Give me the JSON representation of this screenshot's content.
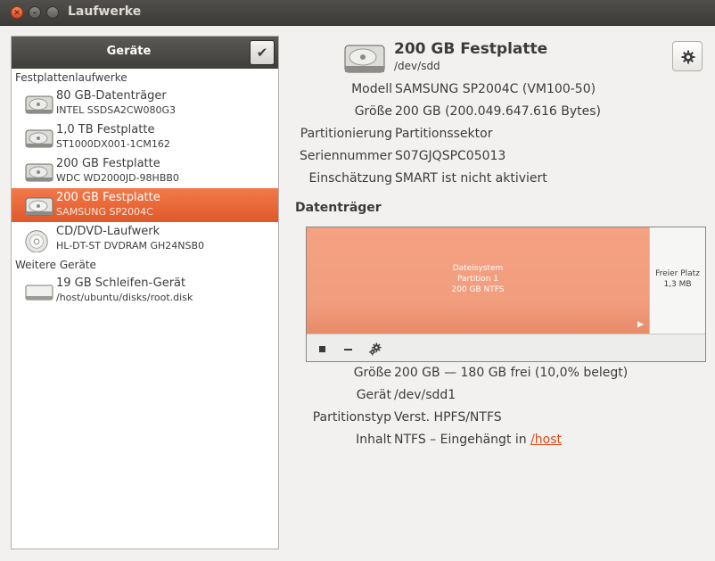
{
  "window": {
    "title": "Laufwerke"
  },
  "sidebar": {
    "header": "Geräte",
    "sections": [
      {
        "title": "Festplattenlaufwerke"
      },
      {
        "title": "Weitere Geräte"
      }
    ],
    "items": [
      {
        "name": "80 GB-Datenträger",
        "sub": "INTEL SSDSA2CW080G3",
        "icon": "harddisk-icon"
      },
      {
        "name": "1,0 TB Festplatte",
        "sub": "ST1000DX001-1CM162",
        "icon": "harddisk-icon"
      },
      {
        "name": "200 GB Festplatte",
        "sub": "WDC WD2000JD-98HBB0",
        "icon": "harddisk-icon"
      },
      {
        "name": "200 GB Festplatte",
        "sub": "SAMSUNG SP2004C",
        "icon": "harddisk-icon",
        "selected": true
      },
      {
        "name": "CD/DVD-Laufwerk",
        "sub": "HL-DT-ST DVDRAM GH24NSB0",
        "icon": "optical-disc-icon"
      },
      {
        "name": "19 GB Schleifen-Gerät",
        "sub": "/host/ubuntu/disks/root.disk",
        "icon": "loop-device-icon"
      }
    ]
  },
  "drive": {
    "title": "200 GB Festplatte",
    "device": "/dev/sdd",
    "props": [
      {
        "key": "Modell",
        "value": "SAMSUNG SP2004C (VM100-50)"
      },
      {
        "key": "Größe",
        "value": "200 GB (200.049.647.616 Bytes)"
      },
      {
        "key": "Partitionierung",
        "value": "Partitionssektor"
      },
      {
        "key": "Seriennummer",
        "value": "S07GJQSPC05013"
      },
      {
        "key": "Einschätzung",
        "value": "SMART ist nicht aktiviert"
      }
    ]
  },
  "volumes": {
    "title": "Datenträger",
    "partition": {
      "line1": "Dateisystem",
      "line2": "Partition 1",
      "line3": "200 GB NTFS"
    },
    "free": {
      "line1": "Freier Platz",
      "line2": "1,3 MB"
    },
    "props": [
      {
        "key": "Größe",
        "value": "200 GB — 180 GB frei (10,0% belegt)"
      },
      {
        "key": "Gerät",
        "value": "/dev/sdd1"
      },
      {
        "key": "Partitionstyp",
        "value": "Verst. HPFS/NTFS"
      },
      {
        "key": "Inhalt",
        "value": "NTFS – Eingehängt in",
        "link": "/host"
      }
    ]
  },
  "colors": {
    "accent": "#e0582a",
    "partition": "#f5a283",
    "link": "#dd4814"
  }
}
